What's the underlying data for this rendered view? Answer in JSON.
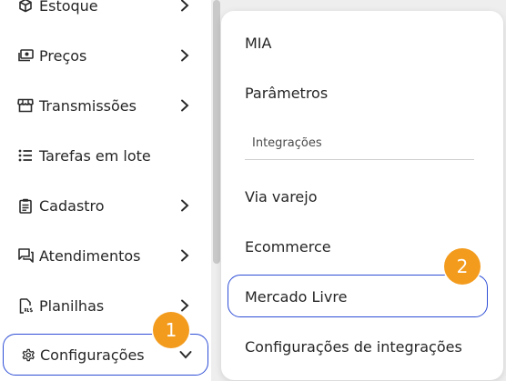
{
  "sidebar": {
    "items": [
      {
        "label": "Estoque",
        "icon": "box-icon",
        "chevron": "right"
      },
      {
        "label": "Preços",
        "icon": "money-icon",
        "chevron": "right"
      },
      {
        "label": "Transmissões",
        "icon": "store-icon",
        "chevron": "right"
      },
      {
        "label": "Tarefas em lote",
        "icon": "list-icon",
        "chevron": "none"
      },
      {
        "label": "Cadastro",
        "icon": "clipboard-icon",
        "chevron": "right"
      },
      {
        "label": "Atendimentos",
        "icon": "chat-icon",
        "chevron": "right"
      },
      {
        "label": "Planilhas",
        "icon": "spreadsheet-file-icon",
        "chevron": "right"
      },
      {
        "label": "Configurações",
        "icon": "gear-icon",
        "chevron": "down",
        "active": true
      }
    ]
  },
  "submenu": {
    "items": [
      "MIA",
      "Parâmetros"
    ],
    "section_label": "Integrações",
    "section_items": [
      "Via varejo",
      "Ecommerce",
      "Mercado Livre",
      "Configurações de integrações"
    ]
  },
  "badges": [
    "1",
    "2"
  ],
  "colors": {
    "accent_border": "#2f4fd6",
    "badge": "#f39b1d",
    "background": "#eeeeee"
  }
}
